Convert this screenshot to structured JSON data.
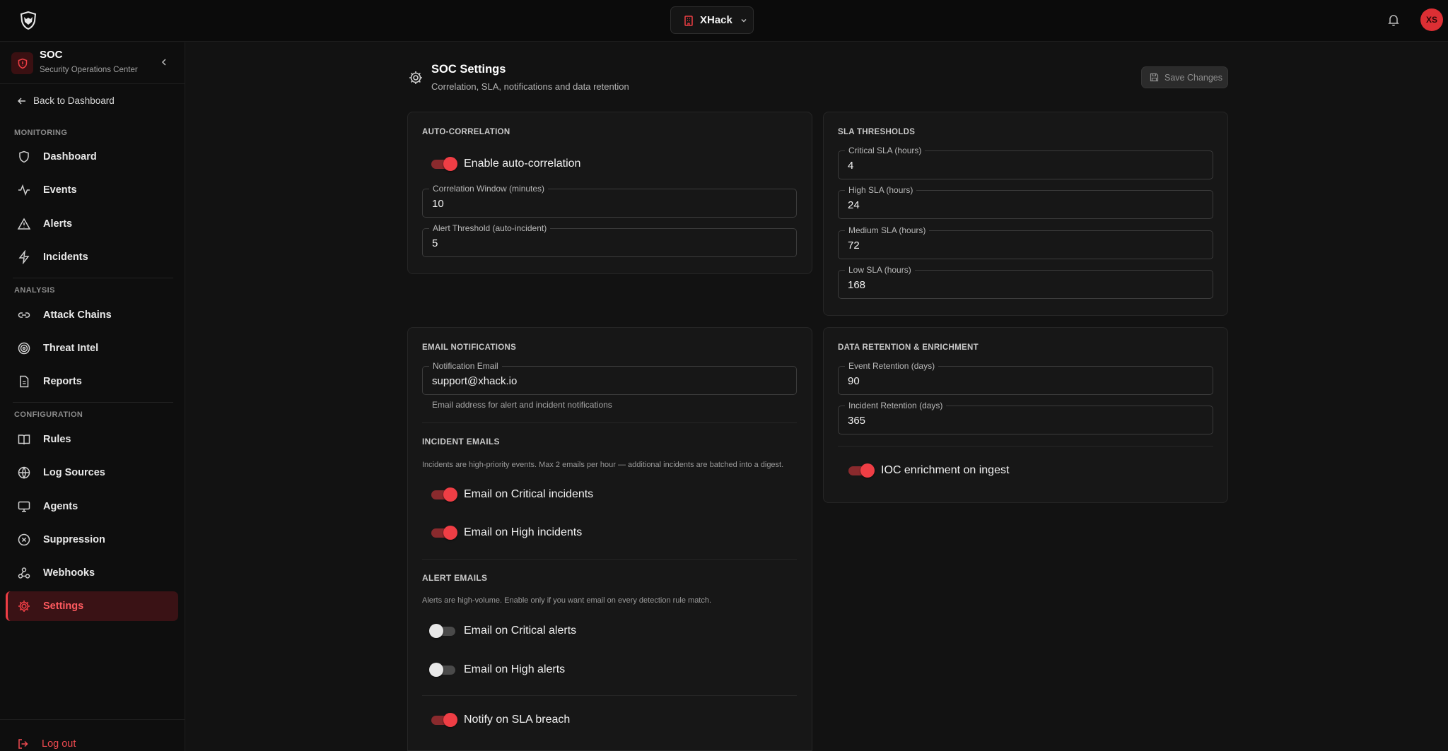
{
  "topbar": {
    "org_name": "XHack",
    "avatar_initials": "XS"
  },
  "sidebar": {
    "app_title": "SOC",
    "app_subtitle": "Security Operations Center",
    "back_label": "Back to Dashboard",
    "sections": {
      "monitoring": "MONITORING",
      "analysis": "ANALYSIS",
      "configuration": "CONFIGURATION"
    },
    "items": {
      "dashboard": "Dashboard",
      "events": "Events",
      "alerts": "Alerts",
      "incidents": "Incidents",
      "attack_chains": "Attack Chains",
      "threat_intel": "Threat Intel",
      "reports": "Reports",
      "rules": "Rules",
      "log_sources": "Log Sources",
      "agents": "Agents",
      "suppression": "Suppression",
      "webhooks": "Webhooks",
      "settings": "Settings"
    },
    "active_item": "settings",
    "logout_label": "Log out"
  },
  "header": {
    "title": "SOC Settings",
    "subtitle": "Correlation, SLA, notifications and data retention",
    "save_label": "Save Changes"
  },
  "auto_correlation": {
    "title": "AUTO-CORRELATION",
    "enable_label": "Enable auto-correlation",
    "enable_on": true,
    "window_label": "Correlation Window (minutes)",
    "window_value": "10",
    "threshold_label": "Alert Threshold (auto-incident)",
    "threshold_value": "5"
  },
  "sla": {
    "title": "SLA THRESHOLDS",
    "critical_label": "Critical SLA (hours)",
    "critical_value": "4",
    "high_label": "High SLA (hours)",
    "high_value": "24",
    "medium_label": "Medium SLA (hours)",
    "medium_value": "72",
    "low_label": "Low SLA (hours)",
    "low_value": "168"
  },
  "email": {
    "title": "EMAIL NOTIFICATIONS",
    "email_label": "Notification Email",
    "email_value": "support@xhack.io",
    "email_helper": "Email address for alert and incident notifications",
    "incident_title": "INCIDENT EMAILS",
    "incident_note": "Incidents are high-priority events. Max 2 emails per hour — additional incidents are batched into a digest.",
    "critical_incidents_label": "Email on Critical incidents",
    "critical_incidents_on": true,
    "high_incidents_label": "Email on High incidents",
    "high_incidents_on": true,
    "alert_title": "ALERT EMAILS",
    "alert_note": "Alerts are high-volume. Enable only if you want email on every detection rule match.",
    "critical_alerts_label": "Email on Critical alerts",
    "critical_alerts_on": false,
    "high_alerts_label": "Email on High alerts",
    "high_alerts_on": false,
    "sla_breach_label": "Notify on SLA breach",
    "sla_breach_on": true
  },
  "retention": {
    "title": "DATA RETENTION & ENRICHMENT",
    "event_label": "Event Retention (days)",
    "event_value": "90",
    "incident_label": "Incident Retention (days)",
    "incident_value": "365",
    "ioc_label": "IOC enrichment on ingest",
    "ioc_on": true
  },
  "colors": {
    "accent": "#ef3e45",
    "background": "#121212",
    "card": "#171717"
  }
}
